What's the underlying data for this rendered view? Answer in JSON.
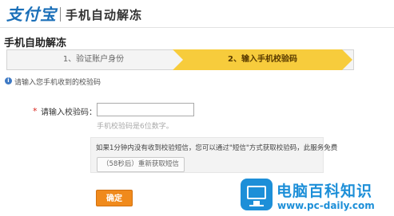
{
  "header": {
    "logo_text": "支付宝",
    "title": "手机自动解冻"
  },
  "page_title": "手机自助解冻",
  "steps": [
    {
      "label": "1、验证账户身份",
      "active": false
    },
    {
      "label": "2、输入手机校验码",
      "active": true
    }
  ],
  "info": {
    "icon": "info-icon",
    "text": "请输入您手机收到的校验码"
  },
  "form": {
    "required_mark": "*",
    "code_label": "请输入校验码：",
    "code_value": "",
    "hint": "手机校验码是6位数字。",
    "notice_text": "如果1分钟内没有收到校验短信，您可以通过\"短信\"方式获取校验码，此服务免费",
    "resend_label": "（58秒后）重新获取短信",
    "confirm_label": "确定"
  },
  "watermark": {
    "title": "电脑百科知识",
    "url": "www.pc-daily.com"
  },
  "colors": {
    "active_step": "#f7cc3c",
    "confirm_button": "#f08a1c",
    "brand_blue": "#1a6fb8",
    "watermark_blue": "#1d8fd8"
  }
}
